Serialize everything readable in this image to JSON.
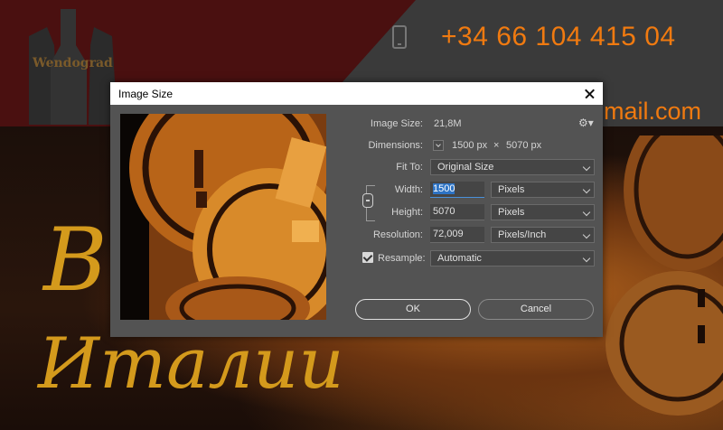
{
  "background": {
    "logo_text": "Wendograd",
    "phone": "+34 66 104 415 04",
    "email_fragment": "mail.com",
    "script_top": "B",
    "script_bottom": "Италии"
  },
  "dialog": {
    "title": "Image Size",
    "image_size": {
      "label": "Image Size:",
      "value": "21,8M"
    },
    "dimensions": {
      "label": "Dimensions:",
      "width": "1500 px",
      "times": "×",
      "height": "5070 px"
    },
    "fit_to": {
      "label": "Fit To:",
      "value": "Original Size"
    },
    "width": {
      "label": "Width:",
      "value": "1500",
      "unit": "Pixels"
    },
    "height": {
      "label": "Height:",
      "value": "5070",
      "unit": "Pixels"
    },
    "resolution": {
      "label": "Resolution:",
      "value": "72,009",
      "unit": "Pixels/Inch"
    },
    "resample": {
      "label": "Resample:",
      "checked": true,
      "value": "Automatic"
    },
    "ok_label": "OK",
    "cancel_label": "Cancel"
  },
  "colors": {
    "accent_orange": "#f07a10",
    "dialog_bg": "#535353",
    "selection_blue": "#2d73c4"
  }
}
